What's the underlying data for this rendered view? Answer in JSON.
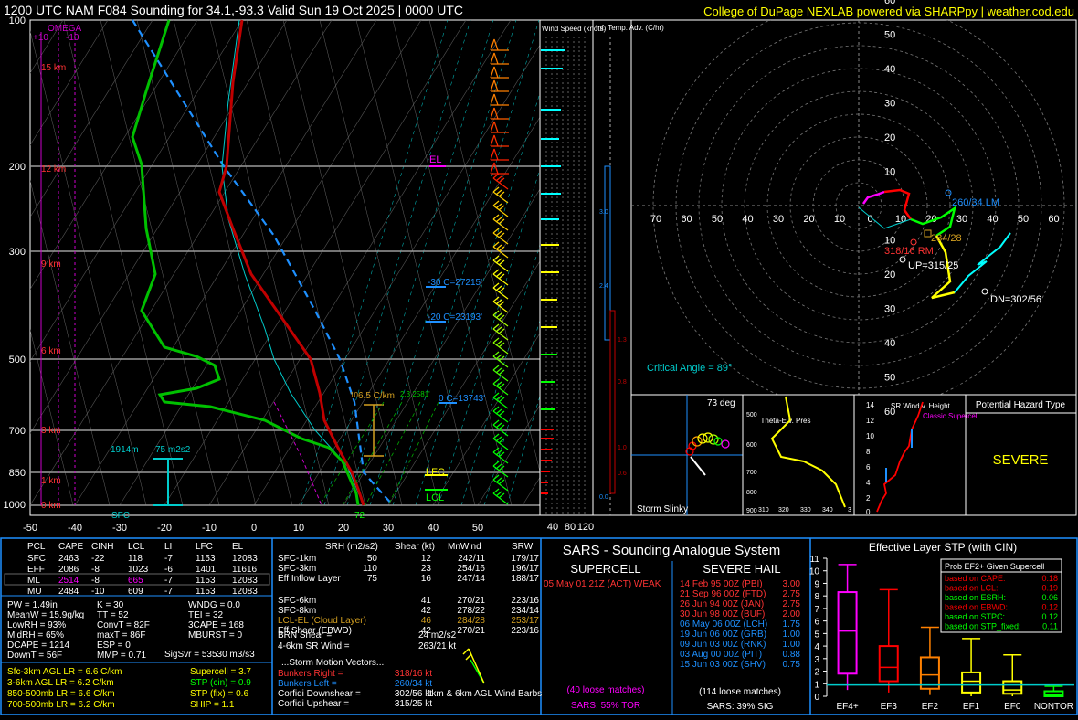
{
  "header": {
    "title": "1200 UTC NAM F084 Sounding for 34.1,-93.3 Valid  Sun 19 Oct 2025 | 0000 UTC",
    "credit": "College of DuPage NEXLAB powered via SHARPpy | weather.cod.edu"
  },
  "colors": {
    "temp": "#c00000",
    "dew": "#00c000",
    "wetbulb": "#00ffff",
    "parcel": "#1e90ff",
    "hodo_0_1": "#ff00ff",
    "hodo_1_3": "#ff0000",
    "hodo_3_6": "#00ff00",
    "hodo_6_9": "#ffff00",
    "hodo_9_12": "#00ffff",
    "panel_border": "#1e90ff"
  },
  "skewt": {
    "pressure_labels": [
      "100",
      "200",
      "300",
      "500",
      "700",
      "850",
      "1000"
    ],
    "height_labels": [
      "15 km",
      "12 km",
      "9 km",
      "6 km",
      "3 km",
      "1 km",
      "0 km"
    ],
    "temp_axis": [
      "-50",
      "-40",
      "-30",
      "-20",
      "-10",
      "0",
      "10",
      "20",
      "30",
      "40",
      "50"
    ],
    "omega_title": "OMEGA",
    "omega_ticks": [
      "+10",
      "-10"
    ],
    "el": "EL",
    "lfc": "LFC",
    "lcl": "LCL",
    "sfc": "SFC",
    "sfc_temp": "72",
    "eff_top": "1914m",
    "eff_srh": "75 m2s2",
    "iso30": "-30 C=27215'",
    "iso20": "-20 C=23193'",
    "iso0": "0 C=13743'",
    "lr": "6.5 C/km",
    "lr_hint": "2.3 2581'",
    "lr_top": "10"
  },
  "windspeed": {
    "title": "Wind Speed (knots)",
    "axis": [
      "40",
      "80",
      "120"
    ]
  },
  "tadv": {
    "title": "Inf. Temp. Adv. (C/hr)",
    "values": [
      "3.0",
      "2.4",
      "1.3",
      "0.8",
      "1.0",
      "0.6",
      "0.0"
    ]
  },
  "hodo": {
    "rings": [
      "10",
      "20",
      "30",
      "40",
      "50",
      "60"
    ],
    "x_axis": [
      "70",
      "60",
      "50",
      "40",
      "30",
      "20",
      "10",
      "0",
      "10",
      "20",
      "30",
      "40",
      "50",
      "60"
    ],
    "lm": "260/34 LM",
    "rm": "318/16 RM",
    "up": "UP=315/25",
    "dn": "DN=302/56",
    "mean": "284/28",
    "critical": "Critical Angle = 89°"
  },
  "slinky": {
    "title": "Storm Slinky",
    "deg": "73 deg"
  },
  "thetae": {
    "title": "Theta-E v. Pres",
    "y": [
      "500",
      "600",
      "700",
      "800",
      "900"
    ],
    "x": [
      "310",
      "320",
      "330",
      "340"
    ],
    "bottom": "3"
  },
  "srwind": {
    "title": "SR Wind v. Height",
    "y": [
      "14",
      "12",
      "10",
      "8",
      "6",
      "4",
      "2",
      "0"
    ],
    "tag": "Classic Supercell"
  },
  "hazard": {
    "title": "Potential Hazard Type",
    "value": "SEVERE"
  },
  "parcels": {
    "headers": [
      "PCL",
      "CAPE",
      "CINH",
      "LCL",
      "LI",
      "LFC",
      "EL"
    ],
    "rows": [
      [
        "SFC",
        "2463",
        "-22",
        "118",
        "-7",
        "1153",
        "12083"
      ],
      [
        "EFF",
        "2086",
        "-8",
        "1023",
        "-6",
        "1401",
        "11616"
      ],
      [
        "ML",
        "2514",
        "-8",
        "665",
        "-7",
        "1153",
        "12083"
      ],
      [
        "MU",
        "2484",
        "-10",
        "609",
        "-7",
        "1153",
        "12083"
      ]
    ]
  },
  "indices": {
    "col1": [
      "PW = 1.49in",
      "MeanW = 15.9g/kg",
      "LowRH = 93%",
      "MidRH = 65%",
      "DCAPE = 1214",
      "DownT = 56F"
    ],
    "col2": [
      "K = 30",
      "TT = 52",
      "ConvT = 82F",
      "maxT = 86F",
      "ESP = 0",
      "MMP = 0.71"
    ],
    "col3": [
      "WNDG = 0.0",
      "TEI = 32",
      "3CAPE = 168",
      "MBURST = 0",
      "",
      ""
    ],
    "sigsvr": "SigSvr = 53530 m3/s3"
  },
  "lapse": {
    "left": [
      "Sfc-3km AGL LR = 6.6 C/km",
      "3-6km AGL LR = 6.2 C/km",
      "850-500mb LR = 6.6 C/km",
      "700-500mb LR = 6.2 C/km"
    ],
    "right": [
      "Supercell = 3.7",
      "STP (cin) = 0.9",
      "STP (fix) = 0.6",
      "SHIP = 1.1"
    ]
  },
  "kinematics": {
    "headers": [
      "SRH (m2/s2)",
      "Shear (kt)",
      "MnWind",
      "SRW"
    ],
    "rows": [
      [
        "SFC-1km",
        "50",
        "12",
        "242/11",
        "179/17"
      ],
      [
        "SFC-3km",
        "110",
        "23",
        "254/16",
        "196/17"
      ],
      [
        "Eff Inflow Layer",
        "75",
        "16",
        "247/14",
        "188/17"
      ],
      [
        "",
        "",
        "",
        "",
        ""
      ],
      [
        "SFC-6km",
        "",
        "41",
        "270/21",
        "223/16"
      ],
      [
        "SFC-8km",
        "",
        "42",
        "278/22",
        "234/14"
      ],
      [
        "LCL-EL (Cloud Layer)",
        "",
        "46",
        "284/28",
        "253/17"
      ],
      [
        "Eff Shear (EBWD)",
        "",
        "42",
        "270/21",
        "223/16"
      ]
    ],
    "brn": "BRN Shear =",
    "brn_v": "24 m2/s2",
    "srw46": "4-6km SR Wind =",
    "srw46_v": "263/21 kt",
    "vec_title": "...Storm Motion Vectors...",
    "vectors": [
      [
        "Bunkers Right =",
        "318/16 kt"
      ],
      [
        "Bunkers Left =",
        "260/34 kt"
      ],
      [
        "Corfidi Downshear =",
        "302/56 kt"
      ],
      [
        "Corfidi Upshear =",
        "315/25 kt"
      ]
    ],
    "barbs_caption": "1km & 6km AGL Wind Barbs"
  },
  "sars": {
    "title": "SARS - Sounding Analogue System",
    "super_title": "SUPERCELL",
    "hail_title": "SEVERE HAIL",
    "super_match": "05 May 01 21Z (ACT)  WEAK",
    "super_loose": "(40 loose matches)",
    "super_tor": "SARS: 55% TOR",
    "hail_matches": [
      [
        "14 Feb 95 00Z (PBI)",
        "3.00"
      ],
      [
        "21 Sep 96 00Z (FTD)",
        "2.75"
      ],
      [
        "26 Jun 94 00Z (JAN)",
        "2.75"
      ],
      [
        "30 Jun 98 00Z (BUF)",
        "2.00"
      ],
      [
        "06 May 06 00Z (LCH)",
        "1.75"
      ],
      [
        "19 Jun 06 00Z (GRB)",
        "1.00"
      ],
      [
        "09 Jun 03 00Z (RNK)",
        "1.00"
      ],
      [
        "03 Aug 00 00Z (PIT)",
        "0.88"
      ],
      [
        "15 Jun 03 00Z (SHV)",
        "0.75"
      ]
    ],
    "hail_loose": "(114 loose matches)",
    "hail_sig": "SARS: 39% SIG"
  },
  "chart_data": {
    "type": "box",
    "title": "Effective Layer STP (with CIN)",
    "categories": [
      "EF4+",
      "EF3",
      "EF2",
      "EF1",
      "EF0",
      "NONTOR"
    ],
    "ylim": [
      0,
      11
    ],
    "yticks": [
      "0",
      "1",
      "2",
      "3",
      "4",
      "5",
      "6",
      "7",
      "8",
      "9",
      "10",
      "11"
    ],
    "boxes": [
      {
        "low": 0.5,
        "q1": 1.8,
        "med": 5.2,
        "q3": 8.3,
        "high": 10.5
      },
      {
        "low": 0.3,
        "q1": 1.2,
        "med": 2.3,
        "q3": 4.0,
        "high": 8.5
      },
      {
        "low": 0.1,
        "q1": 0.6,
        "med": 1.7,
        "q3": 3.1,
        "high": 5.5
      },
      {
        "low": 0.0,
        "q1": 0.3,
        "med": 1.2,
        "q3": 1.9,
        "high": 4.6
      },
      {
        "low": 0.0,
        "q1": 0.2,
        "med": 0.5,
        "q3": 1.2,
        "high": 3.3
      },
      {
        "low": 0.0,
        "q1": 0.0,
        "med": 0.1,
        "q3": 0.4,
        "high": 0.8
      }
    ],
    "box_colors": [
      "#ff00ff",
      "#ff0000",
      "#ff8000",
      "#ffff00",
      "#ffff00",
      "#00ff00"
    ],
    "current_value": 0.9,
    "prob_title": "Prob EF2+ Given Supercell",
    "probs": [
      [
        "based on CAPE:",
        "0.18"
      ],
      [
        "based on LCL:",
        "0.19"
      ],
      [
        "based on ESRH:",
        "0.06"
      ],
      [
        "based on EBWD:",
        "0.12"
      ],
      [
        "based on STPC:",
        "0.12"
      ],
      [
        "based on STP_fixed:",
        "0.11"
      ]
    ],
    "prob_colors": [
      "#ff0000",
      "#ff0000",
      "#00ff00",
      "#ff0000",
      "#00ff00",
      "#00ff00"
    ]
  }
}
